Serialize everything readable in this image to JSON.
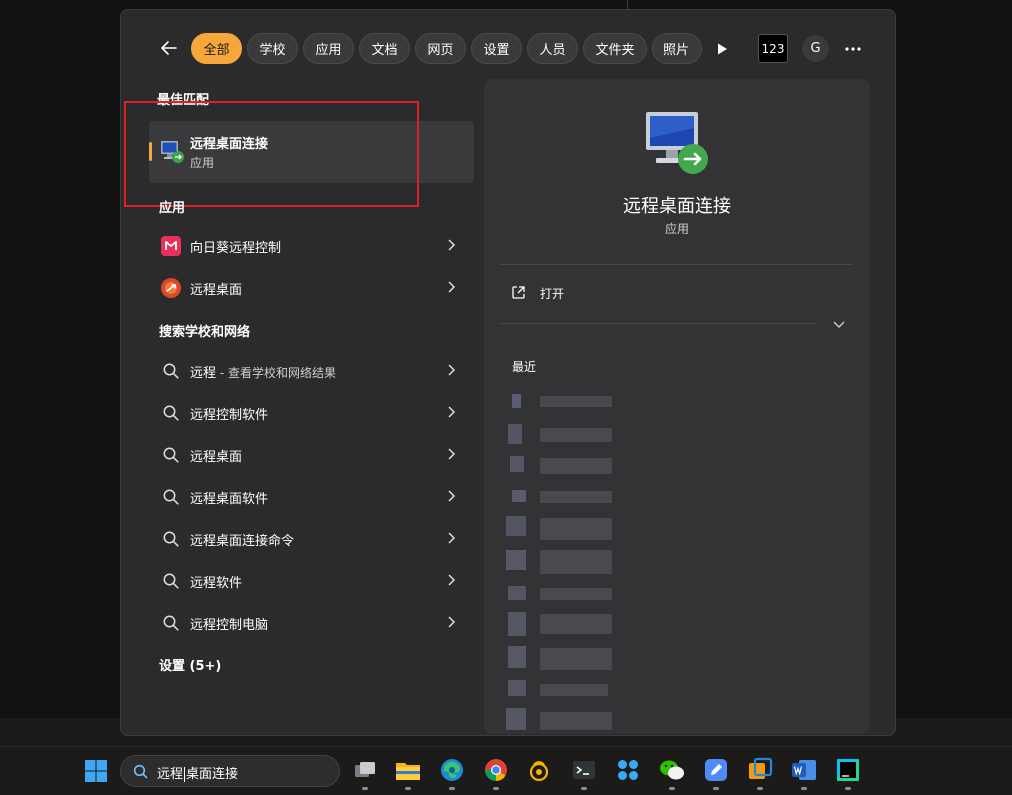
{
  "filter_bar": {
    "back_label": "←",
    "chips": [
      "全部",
      "学校",
      "应用",
      "文档",
      "网页",
      "设置",
      "人员",
      "文件夹",
      "照片"
    ],
    "active_chip": "全部",
    "counter_label": "123",
    "account_initial": "G"
  },
  "best_match": {
    "title": "最佳匹配",
    "item": {
      "name": "远程桌面连接",
      "type": "应用",
      "icon": "remote-desktop-icon"
    }
  },
  "apps": {
    "title": "应用",
    "items": [
      {
        "name": "向日葵远程控制",
        "icon": "sunlogin-icon"
      },
      {
        "name": "远程桌面",
        "icon": "remote-desktop-app-icon"
      }
    ]
  },
  "web_search": {
    "title": "搜索学校和网络",
    "first": {
      "query": "远程",
      "suffix": " - 查看学校和网络结果"
    },
    "items": [
      "远程控制软件",
      "远程桌面",
      "远程桌面软件",
      "远程桌面连接命令",
      "远程软件",
      "远程控制电脑"
    ]
  },
  "settings": {
    "title": "设置 (5+)"
  },
  "preview": {
    "name": "远程桌面连接",
    "type": "应用",
    "open_label": "打开",
    "recent_title": "最近"
  },
  "taskbar": {
    "search_text_before": "远程",
    "search_text_after": "桌面连接",
    "apps": [
      "task-view",
      "file-explorer",
      "edge",
      "chrome",
      "sunlogin",
      "terminal",
      "app-grid",
      "wechat",
      "note",
      "virtualbox",
      "word",
      "webstorm"
    ]
  },
  "colors": {
    "accent": "#f7a73a",
    "highlight": "#e02020",
    "panel": "#2b2b2d",
    "preview": "#333335"
  }
}
